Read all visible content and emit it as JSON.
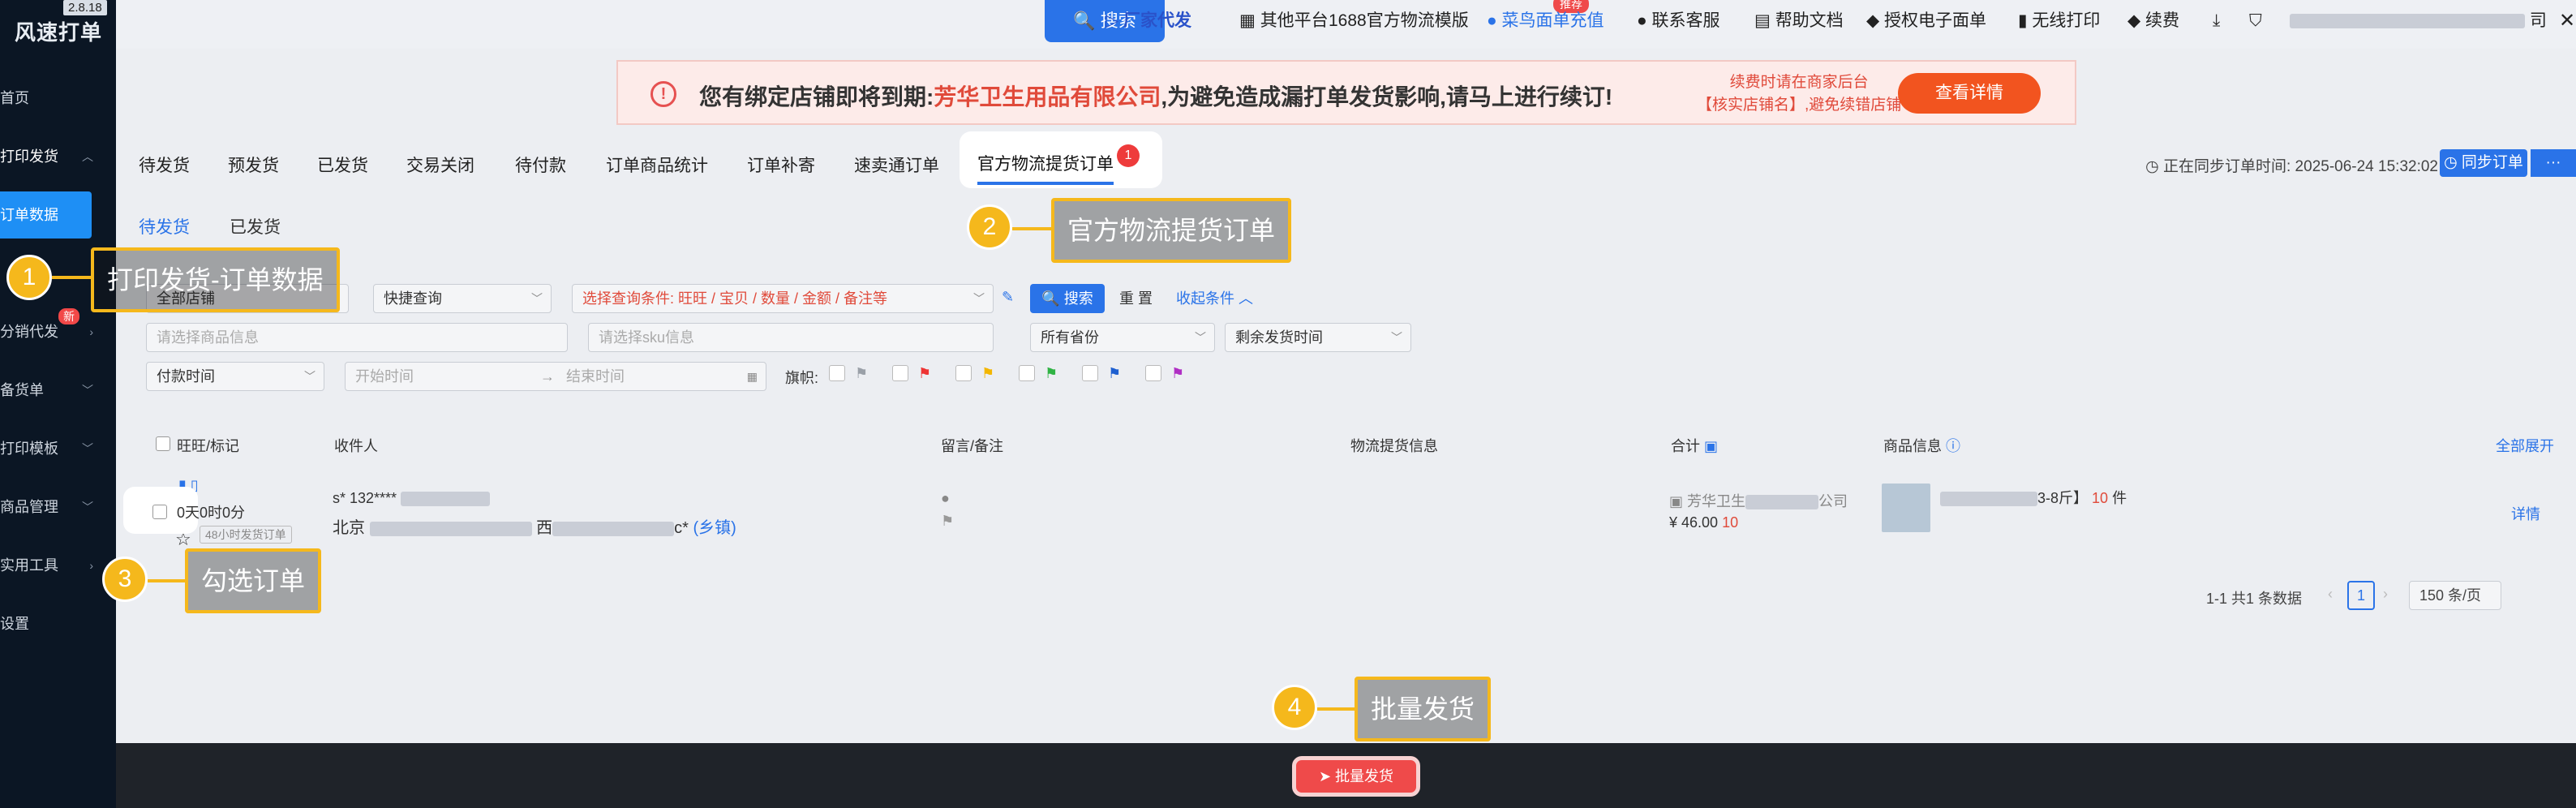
{
  "app": {
    "name": "风速打单",
    "version": "2.8.18"
  },
  "sidebar": {
    "items": [
      {
        "label": "首页"
      },
      {
        "label": "打印发货"
      },
      {
        "label": "订单数据"
      },
      {
        "label": "分销代发"
      },
      {
        "label": "备货单"
      },
      {
        "label": "打印模板"
      },
      {
        "label": "商品管理"
      },
      {
        "label": "实用工具"
      },
      {
        "label": "设置"
      }
    ],
    "new_badge": "新"
  },
  "topbar": {
    "search": "搜索",
    "items": [
      "厂家代发",
      "其他平台",
      "1688官方物流模版",
      "菜鸟面单充值",
      "联系客服",
      "帮助文档",
      "授权电子面单",
      "无线打印",
      "续费"
    ],
    "recommend_badge": "推荐",
    "account_tail": "司"
  },
  "banner": {
    "msg_prefix": "您有绑定店铺即将到期:",
    "shop": "芳华卫生用品有限公司",
    "msg_suffix": ",为避免造成漏打单发货影响,请马上进行续订!",
    "hint_line1": "续费时请在商家后台",
    "hint_line2": "【核实店铺名】,避免续错店铺",
    "detail_button": "查看详情"
  },
  "tabs": [
    {
      "label": "待发货"
    },
    {
      "label": "预发货"
    },
    {
      "label": "已发货"
    },
    {
      "label": "交易关闭"
    },
    {
      "label": "待付款"
    },
    {
      "label": "订单商品统计"
    },
    {
      "label": "订单补寄"
    },
    {
      "label": "速卖通订单"
    }
  ],
  "official_tab": {
    "label": "官方物流提货订单",
    "count": "1"
  },
  "sync": {
    "text": "正在同步订单时间: 2025-06-24 15:32:02",
    "button": "同步订单",
    "more": "···"
  },
  "subtabs": [
    {
      "label": "待发货"
    },
    {
      "label": "已发货"
    }
  ],
  "filters": {
    "all_shops": "全部店铺",
    "quick_query": "快捷查询",
    "query_condition": "选择查询条件: 旺旺 / 宝贝 / 数量 / 金额 / 备注等",
    "search": "搜索",
    "reset": "重 置",
    "collapse": "收起条件",
    "goods_placeholder": "请选择商品信息",
    "sku_placeholder": "请选择sku信息",
    "province": "所有省份",
    "remaining": "剩余发货时间",
    "pay_time": "付款时间",
    "start_time": "开始时间",
    "end_time": "结束时间",
    "flag_label": "旗帜:"
  },
  "table": {
    "headers": {
      "wangwang": "旺旺/标记",
      "receiver": "收件人",
      "remark": "留言/备注",
      "logistics": "物流提货信息",
      "total": "合计",
      "goods": "商品信息",
      "expand": "全部展开"
    },
    "row": {
      "time_left": "0天0时0分",
      "tag": "48小时发货订单",
      "phone": "s* 132****",
      "address_city": "北京",
      "address_mid": "西",
      "address_end": "c*",
      "township": "(乡镇)",
      "company": "芳华卫生",
      "company_tail": "公司",
      "amount": "¥ 46.00",
      "amount_tail": "10",
      "goods_spec": "3-8斤】",
      "goods_qty": "10",
      "goods_unit": "件",
      "detail": "详情"
    }
  },
  "pager": {
    "summary": "1-1 共1 条数据",
    "page": "1",
    "size": "150 条/页"
  },
  "bulk_button": "批量发货",
  "callouts": [
    {
      "num": "1",
      "text": "打印发货-订单数据"
    },
    {
      "num": "2",
      "text": "官方物流提货订单"
    },
    {
      "num": "3",
      "text": "勾选订单"
    },
    {
      "num": "4",
      "text": "批量发货"
    }
  ]
}
